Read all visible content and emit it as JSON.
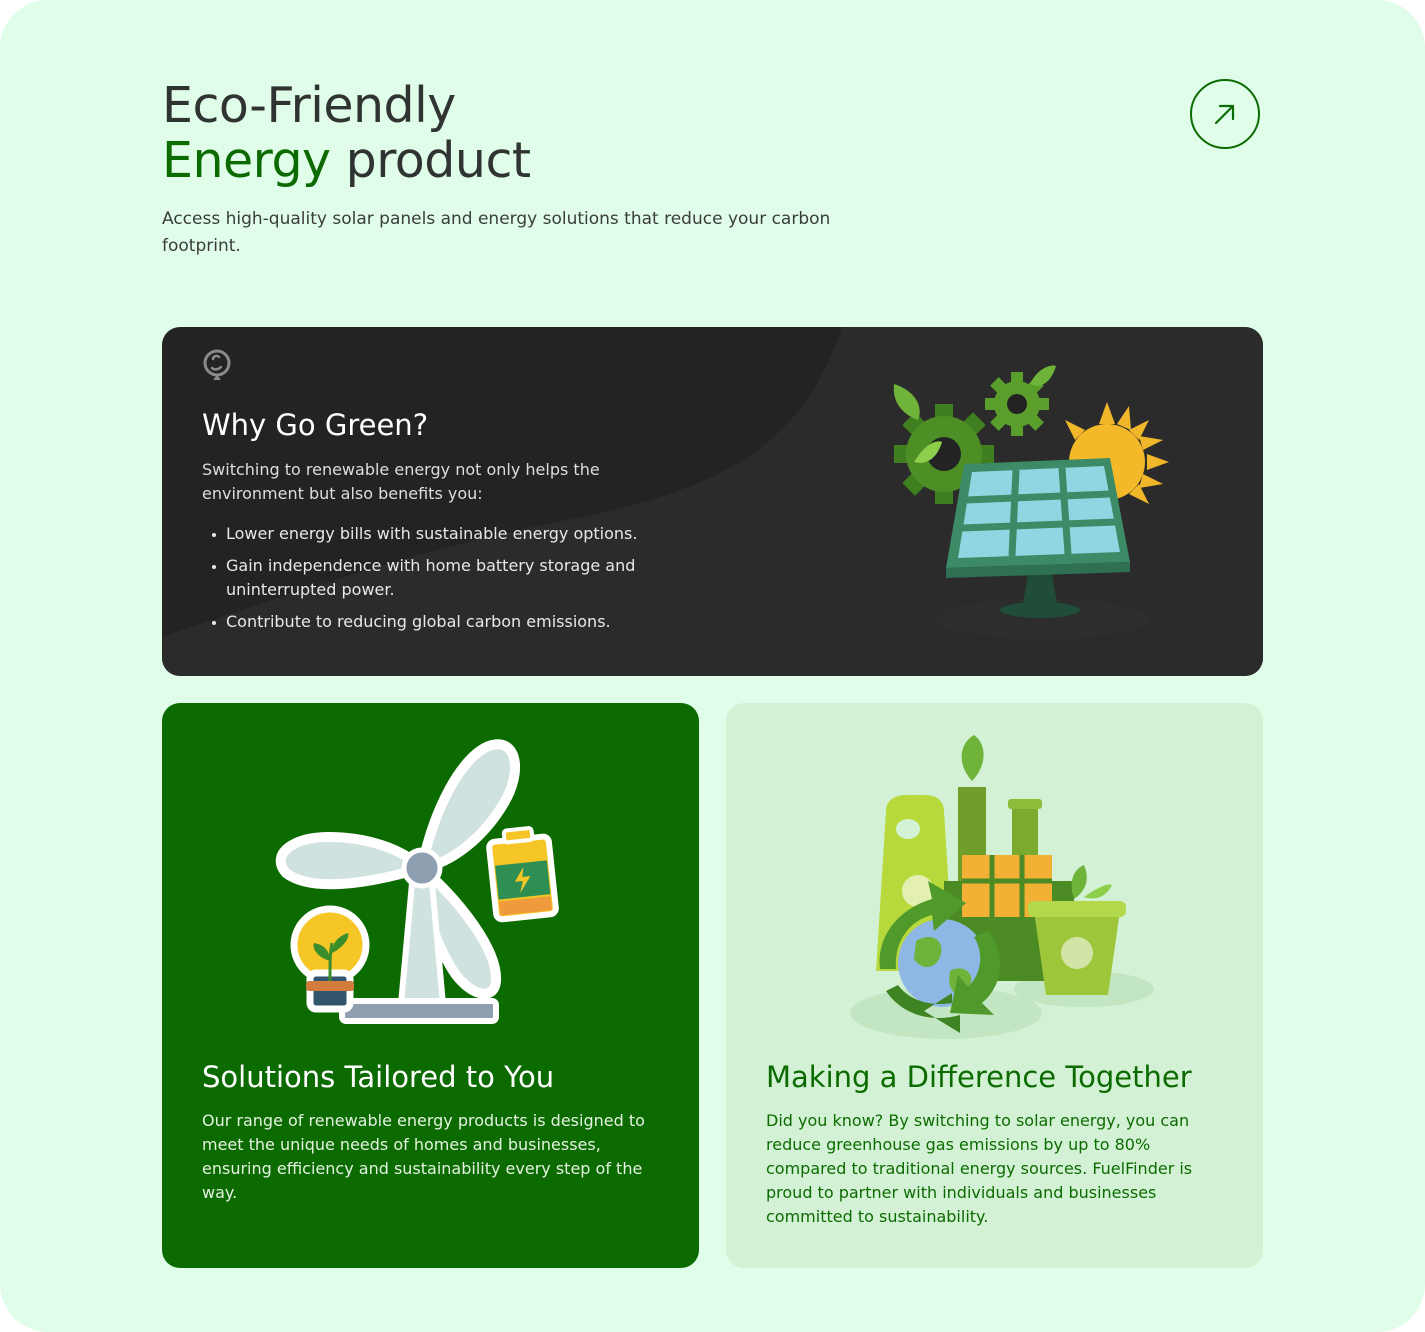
{
  "header": {
    "title_line1": "Eco-Friendly",
    "title_accent": "Energy",
    "title_rest": " product",
    "subtitle": "Access high-quality solar panels and energy solutions that reduce your carbon footprint."
  },
  "why_green": {
    "heading": "Why Go Green?",
    "intro": "Switching to renewable energy not only helps the environment but also benefits you:",
    "bullets": [
      "Lower energy bills with sustainable energy options.",
      "Gain independence with home battery storage and uninterrupted power.",
      "Contribute to reducing global carbon emissions."
    ]
  },
  "solutions": {
    "heading": "Solutions Tailored to You",
    "text": "Our range of renewable energy products is designed to meet the unique needs of homes and businesses, ensuring efficiency and sustainability every step of the way."
  },
  "difference": {
    "heading": "Making a Difference Together",
    "text": "Did you know? By switching to solar energy, you can reduce greenhouse gas emissions by up to 80% compared to traditional energy sources. FuelFinder is proud to partner with individuals and businesses committed to sustainability."
  },
  "colors": {
    "page_bg": "#e0fde9",
    "accent_green": "#0c6b00",
    "dark_card": "#232323",
    "light_card": "#d3f2d5",
    "title_text": "#2f3331"
  },
  "icons": {
    "arrow_button": "arrow-up-right-icon",
    "dark_card_badge": "map-pin-icon"
  }
}
